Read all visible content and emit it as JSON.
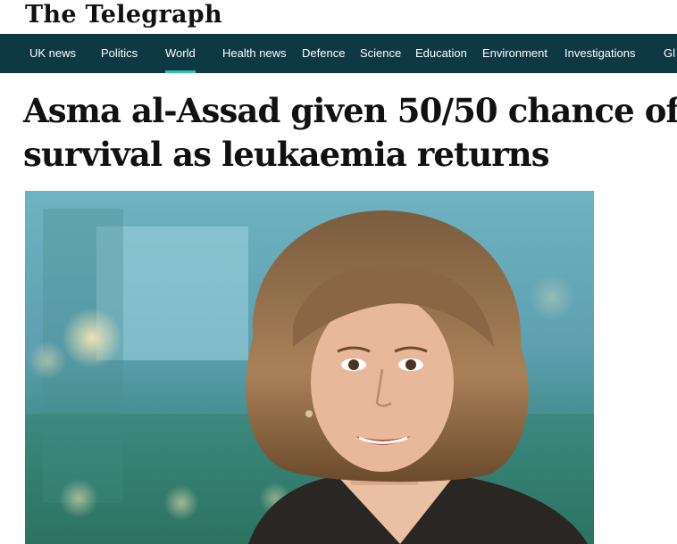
{
  "masthead": {
    "logo_text": "The Telegraph"
  },
  "nav": {
    "items": [
      {
        "label": "UK news",
        "active": false
      },
      {
        "label": "Politics",
        "active": false
      },
      {
        "label": "World",
        "active": true
      },
      {
        "label": "Health news",
        "active": false
      },
      {
        "label": "Defence",
        "active": false
      },
      {
        "label": "Science",
        "active": false
      },
      {
        "label": "Education",
        "active": false
      },
      {
        "label": "Environment",
        "active": false
      },
      {
        "label": "Investigations",
        "active": false
      },
      {
        "label": "Gl",
        "active": false
      }
    ]
  },
  "article": {
    "headline_line1": "Asma al-Assad given 50/50 chance of",
    "headline_line2": "survival as leukaemia returns"
  },
  "colors": {
    "nav_background": "#0f3845",
    "nav_active_underline": "#2ec3b4"
  }
}
